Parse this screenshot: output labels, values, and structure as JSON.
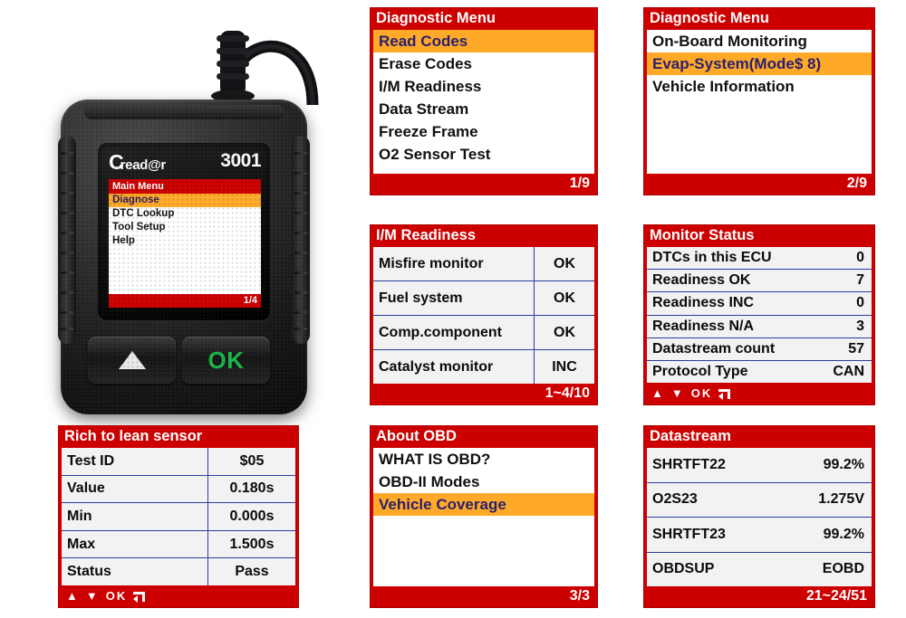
{
  "device": {
    "brand_initial": "C",
    "brand_rest": "read@r",
    "model": "3001",
    "screen": {
      "header": "Main Menu",
      "items": [
        {
          "label": "Diagnose",
          "selected": true
        },
        {
          "label": "DTC Lookup",
          "selected": false
        },
        {
          "label": "Tool Setup",
          "selected": false
        },
        {
          "label": "Help",
          "selected": false
        }
      ],
      "footer": "1/4"
    },
    "buttons": [
      {
        "name": "up-arrow",
        "label": ""
      },
      {
        "name": "ok",
        "label": "OK"
      }
    ]
  },
  "colors": {
    "header_red": "#CC0000",
    "highlight_orange": "#FFA928",
    "highlight_text": "#2A1F6E",
    "row_divider_blue": "#2A3EA0",
    "row_bg": "#F2F2F2",
    "ok_green": "#19B84A"
  },
  "panels": {
    "diagnostic_menu_1": {
      "title": "Diagnostic Menu",
      "type": "menu",
      "items": [
        {
          "label": "Read Codes",
          "selected": true
        },
        {
          "label": "Erase Codes",
          "selected": false
        },
        {
          "label": "I/M Readiness",
          "selected": false
        },
        {
          "label": "Data Stream",
          "selected": false
        },
        {
          "label": "Freeze Frame",
          "selected": false
        },
        {
          "label": "O2 Sensor Test",
          "selected": false
        }
      ],
      "footer": "1/9"
    },
    "diagnostic_menu_2": {
      "title": "Diagnostic Menu",
      "type": "menu",
      "items": [
        {
          "label": "On-Board Monitoring",
          "selected": false
        },
        {
          "label": "Evap-System(Mode$ 8)",
          "selected": true
        },
        {
          "label": "Vehicle Information",
          "selected": false
        }
      ],
      "footer": "2/9"
    },
    "im_readiness": {
      "title": "I/M Readiness",
      "type": "table",
      "rows": [
        {
          "label": "Misfire monitor",
          "value": "OK"
        },
        {
          "label": "Fuel system",
          "value": "OK"
        },
        {
          "label": "Comp.component",
          "value": "OK"
        },
        {
          "label": "Catalyst monitor",
          "value": "INC"
        }
      ],
      "footer": "1~4/10"
    },
    "monitor_status": {
      "title": "Monitor Status",
      "type": "table-nodivider",
      "rows": [
        {
          "label": "DTCs in this ECU",
          "value": "0"
        },
        {
          "label": "Readiness OK",
          "value": "7"
        },
        {
          "label": "Readiness INC",
          "value": "0"
        },
        {
          "label": "Readiness N/A",
          "value": "3"
        },
        {
          "label": "Datastream count",
          "value": "57"
        },
        {
          "label": "Protocol Type",
          "value": "CAN"
        }
      ],
      "footer_glyphs": {
        "up": "▲",
        "down": "▼",
        "ok": "OK",
        "return": "return-arrow"
      }
    },
    "rich_to_lean": {
      "title": "Rich to lean sensor",
      "type": "table",
      "rows": [
        {
          "label": "Test ID",
          "value": "$05"
        },
        {
          "label": "Value",
          "value": "0.180s"
        },
        {
          "label": "Min",
          "value": "0.000s"
        },
        {
          "label": "Max",
          "value": "1.500s"
        },
        {
          "label": "Status",
          "value": "Pass"
        }
      ],
      "footer_glyphs": {
        "up": "▲",
        "down": "▼",
        "ok": "OK",
        "return": "return-arrow"
      }
    },
    "about_obd": {
      "title": "About OBD",
      "type": "menu",
      "items": [
        {
          "label": "WHAT IS OBD?",
          "selected": false
        },
        {
          "label": "OBD-II Modes",
          "selected": false
        },
        {
          "label": "Vehicle Coverage",
          "selected": true
        }
      ],
      "footer": "3/3"
    },
    "datastream": {
      "title": "Datastream",
      "type": "table-nodivider",
      "rows": [
        {
          "label": "SHRTFT22",
          "value": "99.2%"
        },
        {
          "label": "O2S23",
          "value": "1.275V"
        },
        {
          "label": "SHRTFT23",
          "value": "99.2%"
        },
        {
          "label": "OBDSUP",
          "value": "EOBD"
        }
      ],
      "footer": "21~24/51"
    }
  }
}
